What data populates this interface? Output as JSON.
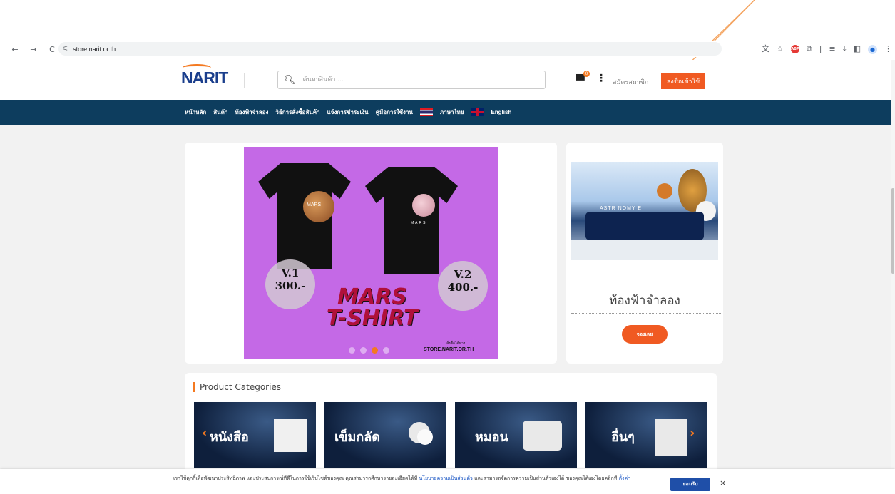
{
  "browser": {
    "url": "store.narit.or.th",
    "back_icon": "←",
    "forward_icon": "→",
    "reload_icon": "C",
    "tune_icon": "⚟"
  },
  "header": {
    "logo": "NARIT",
    "search_placeholder": "ค้นหาสินค้า ...",
    "cart_count": "0",
    "register": "สมัครสมาชิก",
    "login": "ลงชื่อเข้าใช้"
  },
  "nav": {
    "items": [
      "หน้าหลัก",
      "สินค้า",
      "ท้องฟ้าจำลอง",
      "วิธีการสั่งซื้อสินค้า",
      "แจ้งการชำระเงิน",
      "คู่มือการใช้งาน"
    ],
    "lang_th": "ภาษาไทย",
    "lang_en": "English"
  },
  "banner": {
    "planet_label": "MARS",
    "shirt_label": "MARS",
    "v1_version": "V.1",
    "v1_price": "300.-",
    "v2_version": "V.2",
    "v2_price": "400.-",
    "title_line1": "MARS",
    "title_line2": "T-SHIRT",
    "preorder": "สั่งซื้อได้ทาง",
    "store_url": "STORE.NARIT.OR.TH",
    "active_slide": 3
  },
  "planetarium": {
    "sign": "ASTR NOMY E",
    "title": "ท้องฟ้าจำลอง",
    "button": "จองเลย"
  },
  "categories": {
    "heading": "Product Categories",
    "items": [
      "หนังสือ",
      "เข็มกลัด",
      "หมอน",
      "อื่นๆ"
    ]
  },
  "cookie": {
    "text_part1": "เราใช้คุกกี้เพื่อพัฒนาประสิทธิภาพ และประสบการณ์ที่ดีในการใช้เว็บไซต์ของคุณ คุณสามารถศึกษารายละเอียดได้ที่",
    "policy_link": "นโยบายความเป็นส่วนตัว",
    "text_part2": "และสามารถจัดการความเป็นส่วนตัวเองได้ ของคุณได้เองโดยคลิกที่",
    "settings_link": "ตั้งค่า",
    "accept": "ยอมรับ",
    "close": "×"
  },
  "colors": {
    "accent": "#f05a22",
    "nav_bg": "#0d3d5e",
    "annotation_arrow": "#f4a460"
  }
}
